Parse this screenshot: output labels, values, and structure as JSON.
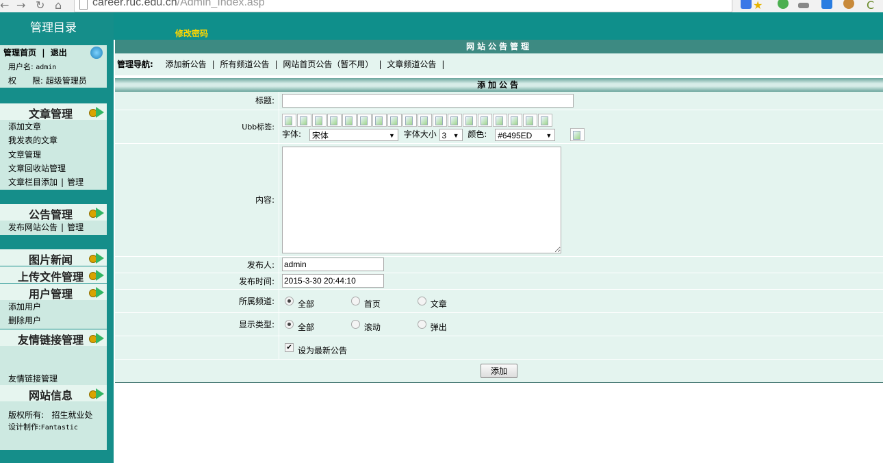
{
  "browser": {
    "url_host": "career.ruc.edu.cn",
    "url_path": "/Admin_Index.asp"
  },
  "sidebar": {
    "title": "管理目录",
    "home_link": "管理首页",
    "logout_link": "退出",
    "user_label": "用户名:",
    "user_value": "admin",
    "perm_label": "权      限:",
    "perm_value": "超级管理员",
    "sections": [
      {
        "title": "文章管理",
        "items": [
          "添加文章",
          "我发表的文章",
          "文章管理",
          "文章回收站管理"
        ],
        "extra": {
          "a": "文章栏目添加",
          "b": "管理"
        }
      },
      {
        "title": "公告管理",
        "extra": {
          "a": "发布网站公告",
          "b": "管理"
        }
      },
      {
        "title": "图片新闻"
      },
      {
        "title": "上传文件管理"
      },
      {
        "title": "用户管理",
        "items": [
          "添加用户",
          "删除用户"
        ]
      },
      {
        "title": "友情链接管理",
        "items": [
          "友情链接管理"
        ]
      },
      {
        "title": "网站信息"
      }
    ],
    "copyright_label": "版权所有:",
    "copyright_value": "招生就业处",
    "design_label": "设计制作:",
    "design_value": "Fantastic"
  },
  "topbar": {
    "change_password": "修改密码"
  },
  "main": {
    "section_title": "网站公告管理",
    "nav_label": "管理导航:",
    "nav_items": [
      "添加新公告",
      "所有频道公告",
      "网站首页公告（暂不用）",
      "文章频道公告"
    ],
    "form_title": "添加公告",
    "fields": {
      "title_label": "标题:",
      "ubb_label": "Ubb标签:",
      "font_label": "字体:",
      "font_value": "宋体",
      "size_label": "字体大小",
      "size_value": "3",
      "color_label": "颜色:",
      "color_value": "#6495ED",
      "content_label": "内容:",
      "publisher_label": "发布人:",
      "publisher_value": "admin",
      "time_label": "发布时间:",
      "time_value": "2015-3-30 20:44:10",
      "channel_label": "所属频道:",
      "channel_options": [
        "全部",
        "首页",
        "文章"
      ],
      "display_label": "显示类型:",
      "display_options": [
        "全部",
        "滚动",
        "弹出"
      ],
      "latest_label": "设为最新公告",
      "submit_label": "添加"
    }
  },
  "colors": {
    "sidebar": "#158e8a",
    "panel": "#cde9e1",
    "form_bg": "#e4f4ef",
    "header": "#3d8a82",
    "link_yellow": "#ffd700"
  }
}
